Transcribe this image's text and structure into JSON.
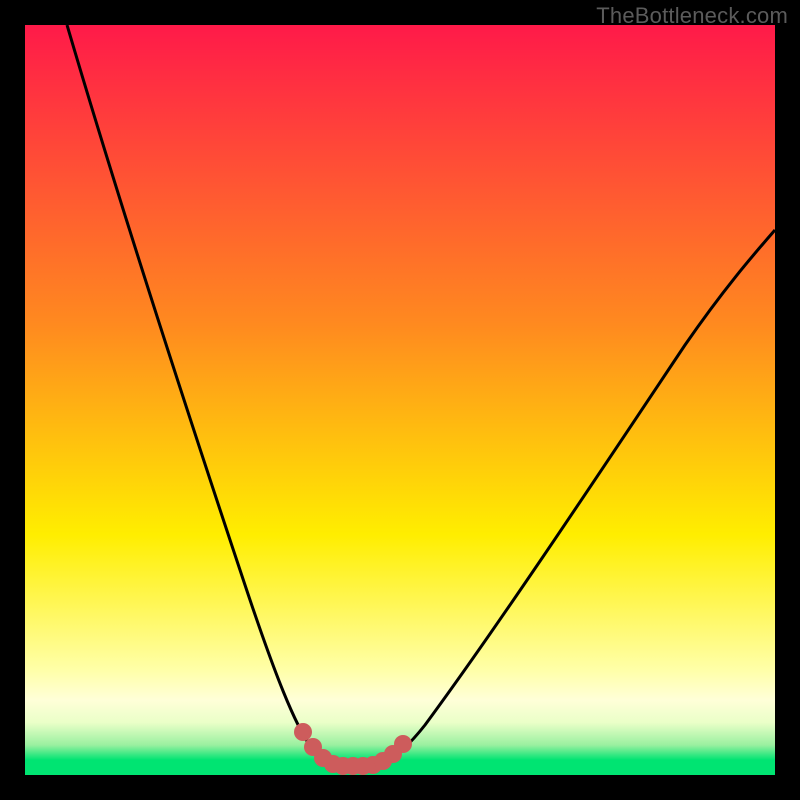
{
  "watermark": "TheBottleneck.com",
  "colors": {
    "red": "#ff1a49",
    "orange": "#ff8a1f",
    "yellow": "#ffee00",
    "pale_yellow": "#ffffb0",
    "cream": "#f6ffd8",
    "green": "#00e472",
    "curve": "#000000",
    "marker": "#cd5c5c"
  },
  "chart_data": {
    "type": "line",
    "title": "",
    "xlabel": "",
    "ylabel": "",
    "xlim": [
      0,
      100
    ],
    "ylim": [
      0,
      100
    ],
    "series": [
      {
        "name": "bottleneck-curve",
        "x": [
          5,
          10,
          15,
          20,
          25,
          30,
          33,
          36,
          38,
          40,
          42,
          44,
          46,
          48,
          50,
          55,
          60,
          65,
          70,
          75,
          80,
          85,
          90,
          95,
          100
        ],
        "values": [
          100,
          83,
          67,
          52,
          38,
          24,
          15,
          8,
          4,
          2,
          1,
          1,
          1,
          2,
          4,
          10,
          17,
          24,
          31,
          38,
          45,
          52,
          59,
          66,
          73
        ]
      }
    ],
    "markers": {
      "name": "bottom-cluster",
      "x": [
        36,
        38,
        39,
        40,
        41,
        42,
        43,
        44,
        45,
        46,
        47,
        48
      ],
      "values": [
        8,
        4,
        3,
        2,
        1.5,
        1.2,
        1.2,
        1.3,
        1.6,
        2,
        2.8,
        4
      ]
    },
    "gradient_stops": [
      {
        "pos": 0,
        "color": "#ff1a49"
      },
      {
        "pos": 40,
        "color": "#ff8a1f"
      },
      {
        "pos": 70,
        "color": "#ffee00"
      },
      {
        "pos": 88,
        "color": "#ffffb0"
      },
      {
        "pos": 93,
        "color": "#f6ffd8"
      },
      {
        "pos": 98,
        "color": "#00e472"
      }
    ]
  }
}
